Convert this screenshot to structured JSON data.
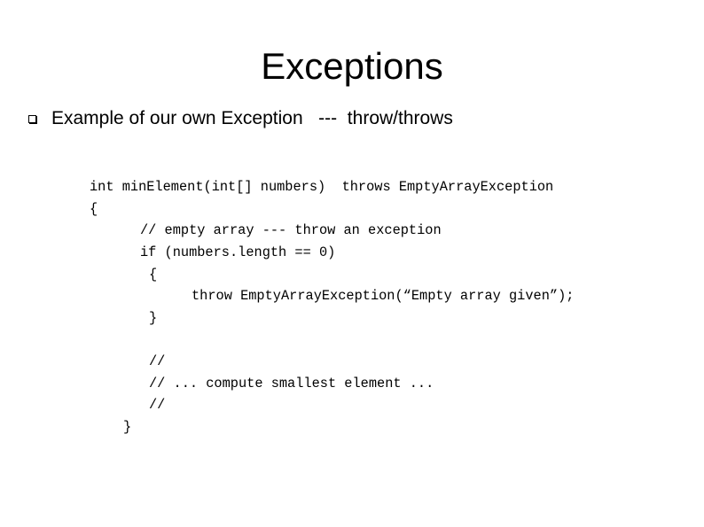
{
  "slide": {
    "title": "Exceptions",
    "bullet": {
      "icon": "hollow-square-bullet",
      "text": "Example of our own Exception   ---  throw/throws"
    },
    "code": [
      "int minElement(int[] numbers)  throws EmptyArrayException",
      "{",
      "// empty array --- throw an exception",
      "if (numbers.length == 0)",
      "{",
      "throw EmptyArrayException(“Empty array given”);",
      "}",
      "//",
      "// ... compute smallest element ...",
      "//",
      "}"
    ]
  }
}
